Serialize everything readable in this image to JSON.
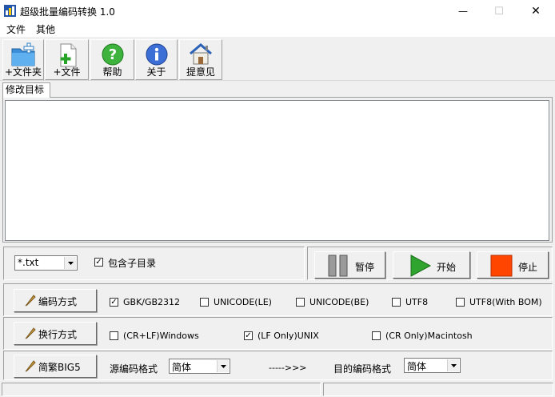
{
  "window": {
    "title": "超级批量编码转换 1.0",
    "minimize": "—",
    "maximize": "☐",
    "close": "✕"
  },
  "menu": {
    "file": "文件",
    "other": "其他"
  },
  "toolbar": {
    "add_folder": "+文件夹",
    "add_file": "+文件",
    "help": "帮助",
    "about": "关于",
    "feedback": "提意见"
  },
  "tab": {
    "label": "修改目标"
  },
  "filter": {
    "value": "*.txt",
    "include_sub_label": "包含子目录",
    "include_sub_checked": true
  },
  "actions": {
    "pause": "暂停",
    "start": "开始",
    "stop": "停止"
  },
  "encoding": {
    "button": "编码方式",
    "options": [
      {
        "label": "GBK/GB2312",
        "checked": true
      },
      {
        "label": "UNICODE(LE)",
        "checked": false
      },
      {
        "label": "UNICODE(BE)",
        "checked": false
      },
      {
        "label": "UTF8",
        "checked": false
      },
      {
        "label": "UTF8(With BOM)",
        "checked": false
      }
    ]
  },
  "linebreak": {
    "button": "换行方式",
    "options": [
      {
        "label": "(CR+LF)Windows",
        "checked": false
      },
      {
        "label": "(LF Only)UNIX",
        "checked": true
      },
      {
        "label": "(CR Only)Macintosh",
        "checked": false
      }
    ]
  },
  "conversion": {
    "button": "简繁BIG5",
    "source_label": "源编码格式",
    "source_value": "简体",
    "arrow": "----->>>",
    "target_label": "目的编码格式",
    "target_value": "简体"
  },
  "colors": {
    "start_green": "#2fa52f",
    "stop_orange": "#ff4500",
    "pencil": "#c89a3c"
  }
}
